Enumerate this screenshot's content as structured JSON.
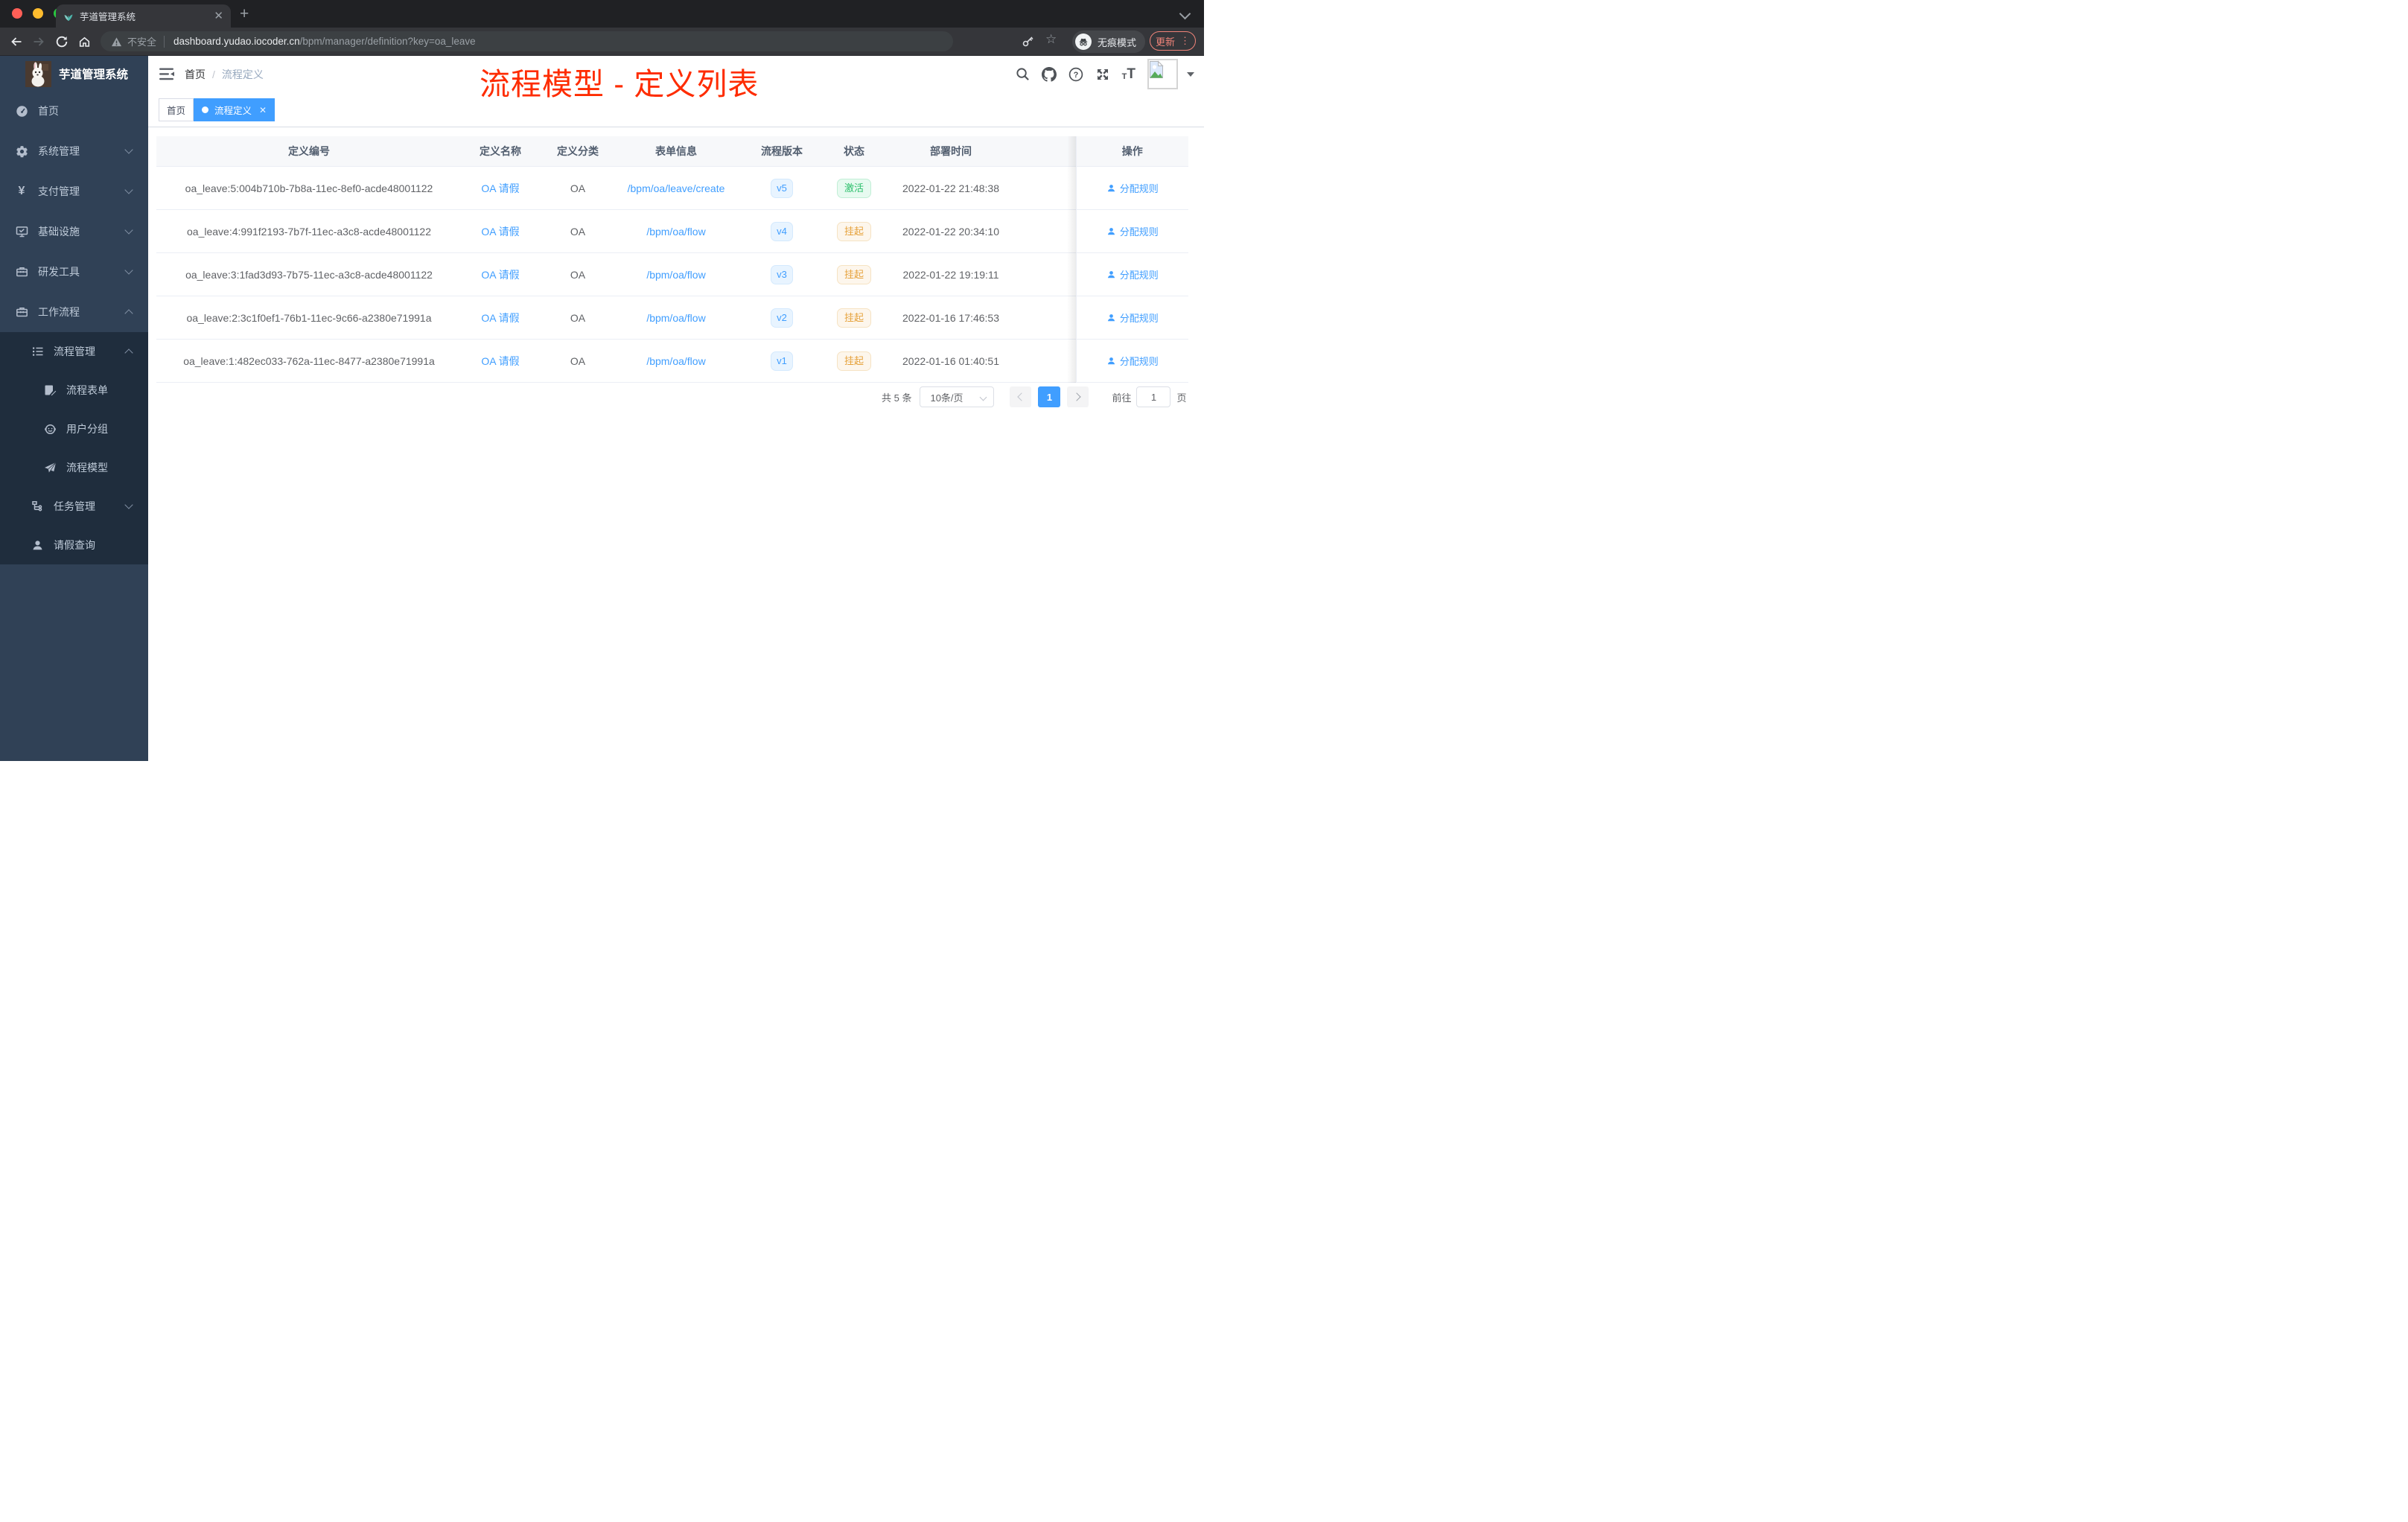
{
  "colors": {
    "accent": "#409eff",
    "annotation": "#fe2c00",
    "success": "#2bbf6b",
    "warning": "#e6a23c",
    "sidebar_bg": "#304156",
    "submenu_bg": "#1f2d3d"
  },
  "browser": {
    "tab_title": "芋道管理系统",
    "security_label": "不安全",
    "url_host": "dashboard.yudao.iocoder.cn",
    "url_path": "/bpm/manager/definition?key=oa_leave",
    "incognito_label": "无痕模式",
    "update_label": "更新"
  },
  "sidebar": {
    "logo_title": "芋道管理系统",
    "menu": [
      {
        "label": "首页",
        "icon": "dashboard",
        "level": 1
      },
      {
        "label": "系统管理",
        "icon": "gear",
        "level": 1,
        "chevron": "down"
      },
      {
        "label": "支付管理",
        "icon": "yen",
        "level": 1,
        "chevron": "down"
      },
      {
        "label": "基础设施",
        "icon": "monitor",
        "level": 1,
        "chevron": "down"
      },
      {
        "label": "研发工具",
        "icon": "toolbox",
        "level": 1,
        "chevron": "down"
      },
      {
        "label": "工作流程",
        "icon": "briefcase",
        "level": 1,
        "chevron": "up"
      },
      {
        "label": "流程管理",
        "icon": "list",
        "level": 2,
        "chevron": "up"
      },
      {
        "label": "流程表单",
        "icon": "form",
        "level": 3
      },
      {
        "label": "用户分组",
        "icon": "robot",
        "level": 3
      },
      {
        "label": "流程模型",
        "icon": "send",
        "level": 3
      },
      {
        "label": "任务管理",
        "icon": "tree",
        "level": 2,
        "chevron": "down"
      },
      {
        "label": "请假查询",
        "icon": "user",
        "level": 2
      }
    ]
  },
  "navbar": {
    "breadcrumb_home": "首页",
    "breadcrumb_sep": "/",
    "breadcrumb_current": "流程定义"
  },
  "annotation": {
    "title": "流程模型 - 定义列表"
  },
  "tags": {
    "home": "首页",
    "current": "流程定义"
  },
  "table": {
    "columns": [
      "定义编号",
      "定义名称",
      "定义分类",
      "表单信息",
      "流程版本",
      "状态",
      "部署时间",
      "操作"
    ],
    "rows": [
      {
        "id": "oa_leave:5:004b710b-7b8a-11ec-8ef0-acde48001122",
        "name": "OA 请假",
        "category": "OA",
        "form": "/bpm/oa/leave/create",
        "version": "v5",
        "status": "激活",
        "status_type": "success",
        "deployed_at": "2022-01-22 21:48:38",
        "action": "分配规则"
      },
      {
        "id": "oa_leave:4:991f2193-7b7f-11ec-a3c8-acde48001122",
        "name": "OA 请假",
        "category": "OA",
        "form": "/bpm/oa/flow",
        "version": "v4",
        "status": "挂起",
        "status_type": "warning",
        "deployed_at": "2022-01-22 20:34:10",
        "action": "分配规则"
      },
      {
        "id": "oa_leave:3:1fad3d93-7b75-11ec-a3c8-acde48001122",
        "name": "OA 请假",
        "category": "OA",
        "form": "/bpm/oa/flow",
        "version": "v3",
        "status": "挂起",
        "status_type": "warning",
        "deployed_at": "2022-01-22 19:19:11",
        "action": "分配规则"
      },
      {
        "id": "oa_leave:2:3c1f0ef1-76b1-11ec-9c66-a2380e71991a",
        "name": "OA 请假",
        "category": "OA",
        "form": "/bpm/oa/flow",
        "version": "v2",
        "status": "挂起",
        "status_type": "warning",
        "deployed_at": "2022-01-16 17:46:53",
        "action": "分配规则"
      },
      {
        "id": "oa_leave:1:482ec033-762a-11ec-8477-a2380e71991a",
        "name": "OA 请假",
        "category": "OA",
        "form": "/bpm/oa/flow",
        "version": "v1",
        "status": "挂起",
        "status_type": "warning",
        "deployed_at": "2022-01-16 01:40:51",
        "action": "分配规则"
      }
    ]
  },
  "pagination": {
    "total": "共 5 条",
    "page_size": "10条/页",
    "current": "1",
    "goto": "前往",
    "unit": "页",
    "goto_value": "1"
  }
}
